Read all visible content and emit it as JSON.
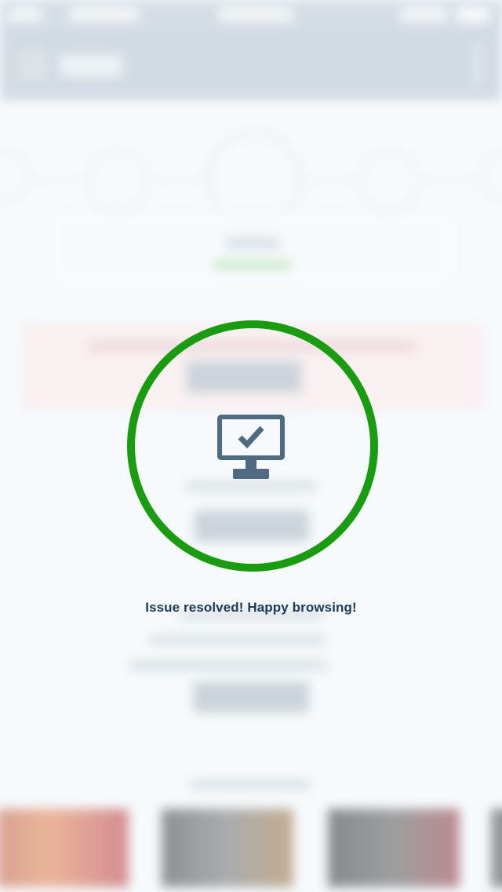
{
  "modal": {
    "message": "Issue resolved! Happy browsing!",
    "icon": "monitor-check-icon",
    "ring_color": "#1a9c11",
    "icon_color": "#4e6b82",
    "text_color": "#1d3b57"
  },
  "background": {
    "state": "blurred"
  }
}
